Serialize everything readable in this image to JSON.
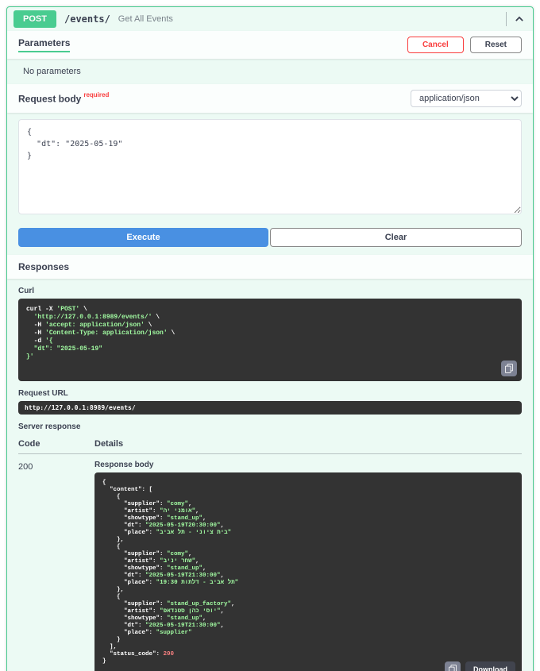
{
  "operation": {
    "method": "POST",
    "path": "/events/",
    "summary": "Get All Events"
  },
  "parameters": {
    "tab_label": "Parameters",
    "cancel_label": "Cancel",
    "reset_label": "Reset",
    "empty_message": "No parameters"
  },
  "request_body": {
    "label": "Request body",
    "required_label": "required",
    "content_type": "application/json",
    "value": "{\n  \"dt\": \"2025-05-19\"\n}"
  },
  "actions": {
    "execute_label": "Execute",
    "clear_label": "Clear"
  },
  "responses": {
    "title": "Responses",
    "curl_label": "Curl",
    "curl_command": "curl -X 'POST' \\\n  'http://127.0.0.1:8989/events/' \\\n  -H 'accept: application/json' \\\n  -H 'Content-Type: application/json' \\\n  -d '{\n  \"dt\": \"2025-05-19\"\n}'",
    "request_url_label": "Request URL",
    "request_url": "http://127.0.0.1:8989/events/",
    "server_response_label": "Server response",
    "code_header": "Code",
    "details_header": "Details",
    "status_code": "200",
    "response_body_label": "Response body",
    "response_body": "{\n  \"content\": [\n    {\n      \"supplier\": \"comy\",\n      \"artist\": \"אומני יה\",\n      \"showtype\": \"stand_up\",\n      \"dt\": \"2025-05-19T20:30:00\",\n      \"place\": \"בית ציוני - תל אביב\"\n    },\n    {\n      \"supplier\": \"comy\",\n      \"artist\": \"שחר יניב\",\n      \"showtype\": \"stand_up\",\n      \"dt\": \"2025-05-19T21:30:00\",\n      \"place\": \"תל אביב - דלתות 19:30\"\n    },\n    {\n      \"supplier\": \"stand_up_factory\",\n      \"artist\": \"יוסי כהן סטנדאפ\",\n      \"showtype\": \"stand_up\",\n      \"dt\": \"2025-05-19T21:30:00\",\n      \"place\": \"supplier\"\n    }\n  ],\n  \"status_code\": 200\n}",
    "download_label": "Download"
  },
  "colors": {
    "method_green": "#49cc90",
    "execute_blue": "#4990e2",
    "cancel_red": "#f93e3e",
    "code_background": "#333333",
    "code_string_green": "#a2fca2",
    "code_number_red": "#f98181"
  }
}
